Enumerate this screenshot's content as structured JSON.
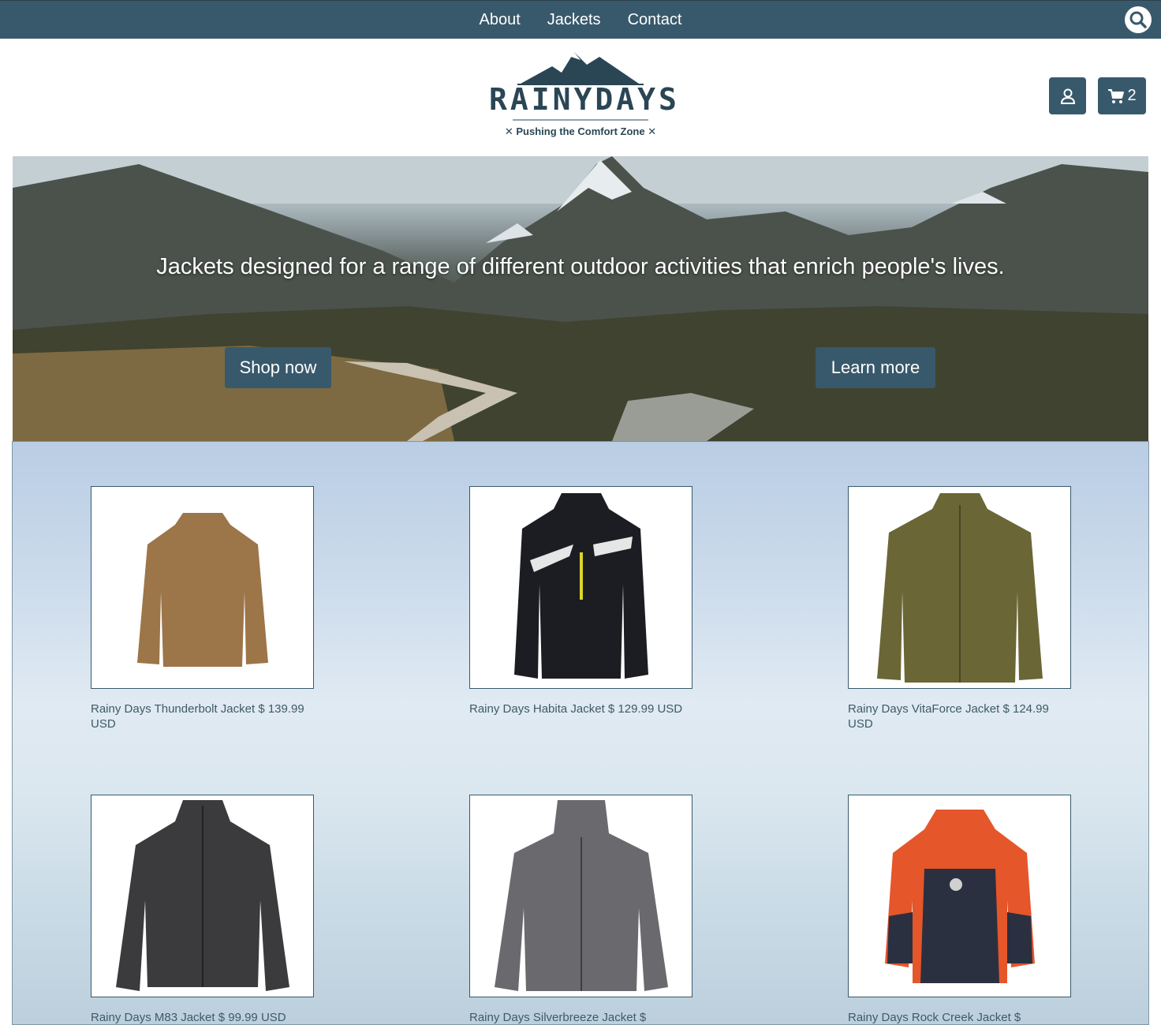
{
  "nav": {
    "links": [
      "About",
      "Jackets",
      "Contact"
    ],
    "search_icon": "search-icon"
  },
  "header": {
    "logo_text": "RAINYDAYS",
    "tagline": "✕ Pushing the Comfort Zone ✕",
    "account_icon": "user-icon",
    "cart_icon": "cart-icon",
    "cart_count": "2"
  },
  "hero": {
    "headline": "Jackets designed for a range of different outdoor activities that enrich people's lives.",
    "shop_label": "Shop now",
    "learn_label": "Learn more"
  },
  "products": [
    {
      "caption": "Rainy Days Thunderbolt Jacket  $ 139.99 USD",
      "color": "#9c7548"
    },
    {
      "caption": "Rainy Days Habita Jacket  $ 129.99 USD",
      "color": "#1c1d22"
    },
    {
      "caption": "Rainy Days VitaForce Jacket  $ 124.99 USD",
      "color": "#6b6636"
    },
    {
      "caption": "Rainy Days M83 Jacket  $ 99.99 USD",
      "color": "#3b3b3d"
    },
    {
      "caption": "Rainy Days Silverbreeze Jacket  $",
      "color": "#6a6a6e"
    },
    {
      "caption": "Rainy Days Rock Creek Jacket  $",
      "color": "#e5562a"
    }
  ],
  "colors": {
    "brand": "#38596b",
    "text": "#3e5a69"
  }
}
